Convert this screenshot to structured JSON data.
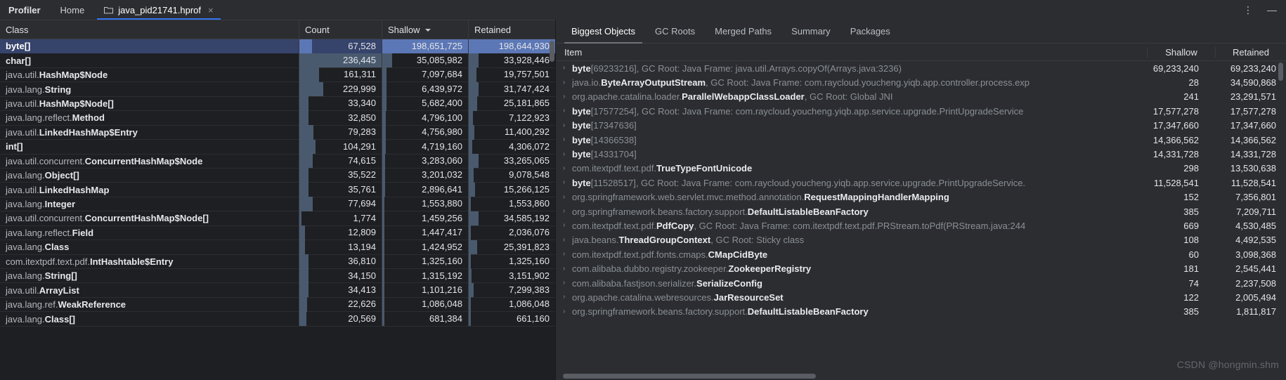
{
  "window": {
    "tool_title": "Profiler",
    "tabs": [
      {
        "label": "Home",
        "icon": "",
        "active": false,
        "closable": false
      },
      {
        "label": "java_pid21741.hprof",
        "icon": "folder-icon",
        "active": true,
        "closable": true
      }
    ],
    "close_glyph": "×",
    "more_options_glyph": "⋮",
    "minimize_glyph": "—"
  },
  "left_table": {
    "columns": [
      "Class",
      "Count",
      "Shallow",
      "Retained"
    ],
    "sort_column": "Shallow",
    "sort_direction": "desc",
    "max_count": 236445,
    "max_shallow": 198651725,
    "max_retained": 198644930,
    "rows": [
      {
        "package": "",
        "cls": "byte[]",
        "count": "67,528",
        "shallow": "198,651,725",
        "retained": "198,644,930",
        "count_n": 67528,
        "shallow_n": 198651725,
        "retained_n": 198644930,
        "selected": true
      },
      {
        "package": "",
        "cls": "char[]",
        "count": "236,445",
        "shallow": "35,085,982",
        "retained": "33,928,446",
        "count_n": 236445,
        "shallow_n": 35085982,
        "retained_n": 33928446,
        "selected": false
      },
      {
        "package": "java.util.",
        "cls": "HashMap$Node",
        "count": "161,311",
        "shallow": "7,097,684",
        "retained": "19,757,501",
        "count_n": 161311,
        "shallow_n": 7097684,
        "retained_n": 19757501,
        "selected": false
      },
      {
        "package": "java.lang.",
        "cls": "String",
        "count": "229,999",
        "shallow": "6,439,972",
        "retained": "31,747,424",
        "count_n": 229999,
        "shallow_n": 6439972,
        "retained_n": 31747424,
        "selected": false
      },
      {
        "package": "java.util.",
        "cls": "HashMap$Node[]",
        "count": "33,340",
        "shallow": "5,682,400",
        "retained": "25,181,865",
        "count_n": 33340,
        "shallow_n": 5682400,
        "retained_n": 25181865,
        "selected": false
      },
      {
        "package": "java.lang.reflect.",
        "cls": "Method",
        "count": "32,850",
        "shallow": "4,796,100",
        "retained": "7,122,923",
        "count_n": 32850,
        "shallow_n": 4796100,
        "retained_n": 7122923,
        "selected": false
      },
      {
        "package": "java.util.",
        "cls": "LinkedHashMap$Entry",
        "count": "79,283",
        "shallow": "4,756,980",
        "retained": "11,400,292",
        "count_n": 79283,
        "shallow_n": 4756980,
        "retained_n": 11400292,
        "selected": false
      },
      {
        "package": "",
        "cls": "int[]",
        "count": "104,291",
        "shallow": "4,719,160",
        "retained": "4,306,072",
        "count_n": 104291,
        "shallow_n": 4719160,
        "retained_n": 4306072,
        "selected": false
      },
      {
        "package": "java.util.concurrent.",
        "cls": "ConcurrentHashMap$Node",
        "count": "74,615",
        "shallow": "3,283,060",
        "retained": "33,265,065",
        "count_n": 74615,
        "shallow_n": 3283060,
        "retained_n": 33265065,
        "selected": false
      },
      {
        "package": "java.lang.",
        "cls": "Object[]",
        "count": "35,522",
        "shallow": "3,201,032",
        "retained": "9,078,548",
        "count_n": 35522,
        "shallow_n": 3201032,
        "retained_n": 9078548,
        "selected": false
      },
      {
        "package": "java.util.",
        "cls": "LinkedHashMap",
        "count": "35,761",
        "shallow": "2,896,641",
        "retained": "15,266,125",
        "count_n": 35761,
        "shallow_n": 2896641,
        "retained_n": 15266125,
        "selected": false
      },
      {
        "package": "java.lang.",
        "cls": "Integer",
        "count": "77,694",
        "shallow": "1,553,880",
        "retained": "1,553,860",
        "count_n": 77694,
        "shallow_n": 1553880,
        "retained_n": 1553860,
        "selected": false
      },
      {
        "package": "java.util.concurrent.",
        "cls": "ConcurrentHashMap$Node[]",
        "count": "1,774",
        "shallow": "1,459,256",
        "retained": "34,585,192",
        "count_n": 1774,
        "shallow_n": 1459256,
        "retained_n": 34585192,
        "selected": false
      },
      {
        "package": "java.lang.reflect.",
        "cls": "Field",
        "count": "12,809",
        "shallow": "1,447,417",
        "retained": "2,036,076",
        "count_n": 12809,
        "shallow_n": 1447417,
        "retained_n": 2036076,
        "selected": false
      },
      {
        "package": "java.lang.",
        "cls": "Class",
        "count": "13,194",
        "shallow": "1,424,952",
        "retained": "25,391,823",
        "count_n": 13194,
        "shallow_n": 1424952,
        "retained_n": 25391823,
        "selected": false
      },
      {
        "package": "com.itextpdf.text.pdf.",
        "cls": "IntHashtable$Entry",
        "count": "36,810",
        "shallow": "1,325,160",
        "retained": "1,325,160",
        "count_n": 36810,
        "shallow_n": 1325160,
        "retained_n": 1325160,
        "selected": false
      },
      {
        "package": "java.lang.",
        "cls": "String[]",
        "count": "34,150",
        "shallow": "1,315,192",
        "retained": "3,151,902",
        "count_n": 34150,
        "shallow_n": 1315192,
        "retained_n": 3151902,
        "selected": false
      },
      {
        "package": "java.util.",
        "cls": "ArrayList",
        "count": "34,413",
        "shallow": "1,101,216",
        "retained": "7,299,383",
        "count_n": 34413,
        "shallow_n": 1101216,
        "retained_n": 7299383,
        "selected": false
      },
      {
        "package": "java.lang.ref.",
        "cls": "WeakReference",
        "count": "22,626",
        "shallow": "1,086,048",
        "retained": "1,086,048",
        "count_n": 22626,
        "shallow_n": 1086048,
        "retained_n": 1086048,
        "selected": false
      },
      {
        "package": "java.lang.",
        "cls": "Class[]",
        "count": "20,569",
        "shallow": "681,384",
        "retained": "661,160",
        "count_n": 20569,
        "shallow_n": 681384,
        "retained_n": 661160,
        "selected": false
      }
    ]
  },
  "right_panel": {
    "tabs": [
      {
        "label": "Biggest Objects",
        "active": true
      },
      {
        "label": "GC Roots",
        "active": false
      },
      {
        "label": "Merged Paths",
        "active": false
      },
      {
        "label": "Summary",
        "active": false
      },
      {
        "label": "Packages",
        "active": false
      }
    ],
    "columns": [
      "Item",
      "Shallow",
      "Retained"
    ],
    "expand_glyph": "›",
    "rows": [
      {
        "pre": "",
        "bold": "byte",
        "post": "[69233216], GC Root: Java Frame: java.util.Arrays.copyOf(Arrays.java:3236)",
        "shallow": "69,233,240",
        "retained": "69,233,240"
      },
      {
        "pre": "java.io.",
        "bold": "ByteArrayOutputStream",
        "post": ", GC Root: Java Frame: com.raycloud.youcheng.yiqb.app.controller.process.exp",
        "shallow": "28",
        "retained": "34,590,868"
      },
      {
        "pre": "org.apache.catalina.loader.",
        "bold": "ParallelWebappClassLoader",
        "post": ", GC Root: Global JNI",
        "shallow": "241",
        "retained": "23,291,571"
      },
      {
        "pre": "",
        "bold": "byte",
        "post": "[17577254], GC Root: Java Frame: com.raycloud.youcheng.yiqb.app.service.upgrade.PrintUpgradeService",
        "shallow": "17,577,278",
        "retained": "17,577,278"
      },
      {
        "pre": "",
        "bold": "byte",
        "post": "[17347636]",
        "shallow": "17,347,660",
        "retained": "17,347,660"
      },
      {
        "pre": "",
        "bold": "byte",
        "post": "[14366538]",
        "shallow": "14,366,562",
        "retained": "14,366,562"
      },
      {
        "pre": "",
        "bold": "byte",
        "post": "[14331704]",
        "shallow": "14,331,728",
        "retained": "14,331,728"
      },
      {
        "pre": "com.itextpdf.text.pdf.",
        "bold": "TrueTypeFontUnicode",
        "post": "",
        "shallow": "298",
        "retained": "13,530,638"
      },
      {
        "pre": "",
        "bold": "byte",
        "post": "[11528517], GC Root: Java Frame: com.raycloud.youcheng.yiqb.app.service.upgrade.PrintUpgradeService.",
        "shallow": "11,528,541",
        "retained": "11,528,541"
      },
      {
        "pre": "org.springframework.web.servlet.mvc.method.annotation.",
        "bold": "RequestMappingHandlerMapping",
        "post": "",
        "shallow": "152",
        "retained": "7,356,801"
      },
      {
        "pre": "org.springframework.beans.factory.support.",
        "bold": "DefaultListableBeanFactory",
        "post": "",
        "shallow": "385",
        "retained": "7,209,711"
      },
      {
        "pre": "com.itextpdf.text.pdf.",
        "bold": "PdfCopy",
        "post": ", GC Root: Java Frame: com.itextpdf.text.pdf.PRStream.toPdf(PRStream.java:244",
        "shallow": "669",
        "retained": "4,530,485"
      },
      {
        "pre": "java.beans.",
        "bold": "ThreadGroupContext",
        "post": ", GC Root: Sticky class",
        "shallow": "108",
        "retained": "4,492,535"
      },
      {
        "pre": "com.itextpdf.text.pdf.fonts.cmaps.",
        "bold": "CMapCidByte",
        "post": "",
        "shallow": "60",
        "retained": "3,098,368"
      },
      {
        "pre": "com.alibaba.dubbo.registry.zookeeper.",
        "bold": "ZookeeperRegistry",
        "post": "",
        "shallow": "181",
        "retained": "2,545,441"
      },
      {
        "pre": "com.alibaba.fastjson.serializer.",
        "bold": "SerializeConfig",
        "post": "",
        "shallow": "74",
        "retained": "2,237,508"
      },
      {
        "pre": "org.apache.catalina.webresources.",
        "bold": "JarResourceSet",
        "post": "",
        "shallow": "122",
        "retained": "2,005,494"
      },
      {
        "pre": "org.springframework.beans.factory.support.",
        "bold": "DefaultListableBeanFactory",
        "post": "",
        "shallow": "385",
        "retained": "1,811,817"
      }
    ]
  },
  "watermark": {
    "text": "CSDN @hongmin.shm"
  },
  "colors": {
    "accent": "#3574f0",
    "selection": "#36436b",
    "bar": "#4a5a6e",
    "bar_selected": "#5c77b5",
    "panel_bg": "#2b2d30",
    "table_bg": "#1e1f22",
    "text": "#dfe1e5",
    "text_muted": "#8b9096"
  }
}
